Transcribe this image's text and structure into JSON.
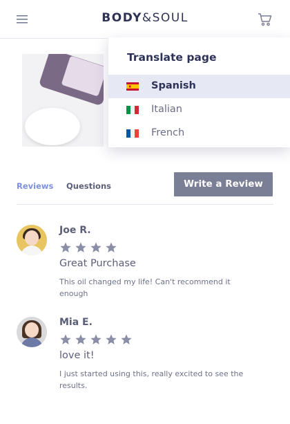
{
  "header": {
    "logo_part1": "BODY",
    "logo_part2": "&SOUL",
    "menu_icon": "hamburger-menu-icon",
    "cart_icon": "shopping-cart-icon"
  },
  "translate": {
    "title": "Translate page",
    "languages": [
      {
        "label": "Spanish",
        "flag": "spain-flag",
        "selected": true
      },
      {
        "label": "Italian",
        "flag": "italy-flag",
        "selected": false
      },
      {
        "label": "French",
        "flag": "france-flag",
        "selected": false
      }
    ]
  },
  "tabs": {
    "reviews": "Reviews",
    "questions": "Questions",
    "active": "Reviews"
  },
  "write_review_label": "Write a Review",
  "reviews": [
    {
      "name": "Joe R.",
      "rating": 4,
      "title": "Great Purchase",
      "body": "This oil changed my life! Can't recommend it enough"
    },
    {
      "name": "Mia E.",
      "rating": 5,
      "title": "love it!",
      "body": "I just started using this, really excited to see the results."
    }
  ],
  "colors": {
    "accent": "#7d8fe0",
    "brand": "#2f3257",
    "star": "#8a8ea6",
    "button": "#7b7f96"
  }
}
